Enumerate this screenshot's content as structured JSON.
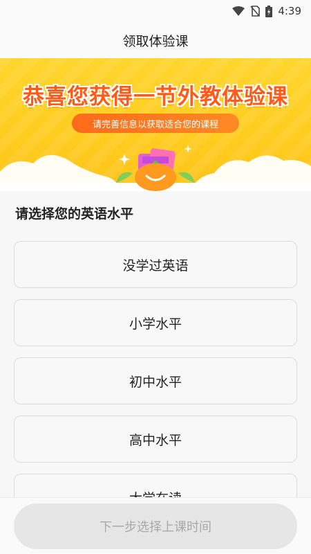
{
  "status_bar": {
    "time": "4:39",
    "icons": [
      "wifi-icon",
      "no-sim-icon",
      "battery-charging-icon"
    ]
  },
  "nav": {
    "title": "领取体验课"
  },
  "banner": {
    "headline": "恭喜您获得一节外教体验课",
    "subline": "请完善信息以获取适合您的课程",
    "art": "orange-mascot-with-gift-boxes",
    "colors": {
      "background": "#ffcc1f",
      "headline": "#ff5a18",
      "pill": "#ff6a1a"
    }
  },
  "level": {
    "title": "请选择您的英语水平",
    "options": [
      "没学过英语",
      "小学水平",
      "初中水平",
      "高中水平",
      "大学在读"
    ]
  },
  "footer": {
    "next_label": "下一步选择上课时间"
  }
}
